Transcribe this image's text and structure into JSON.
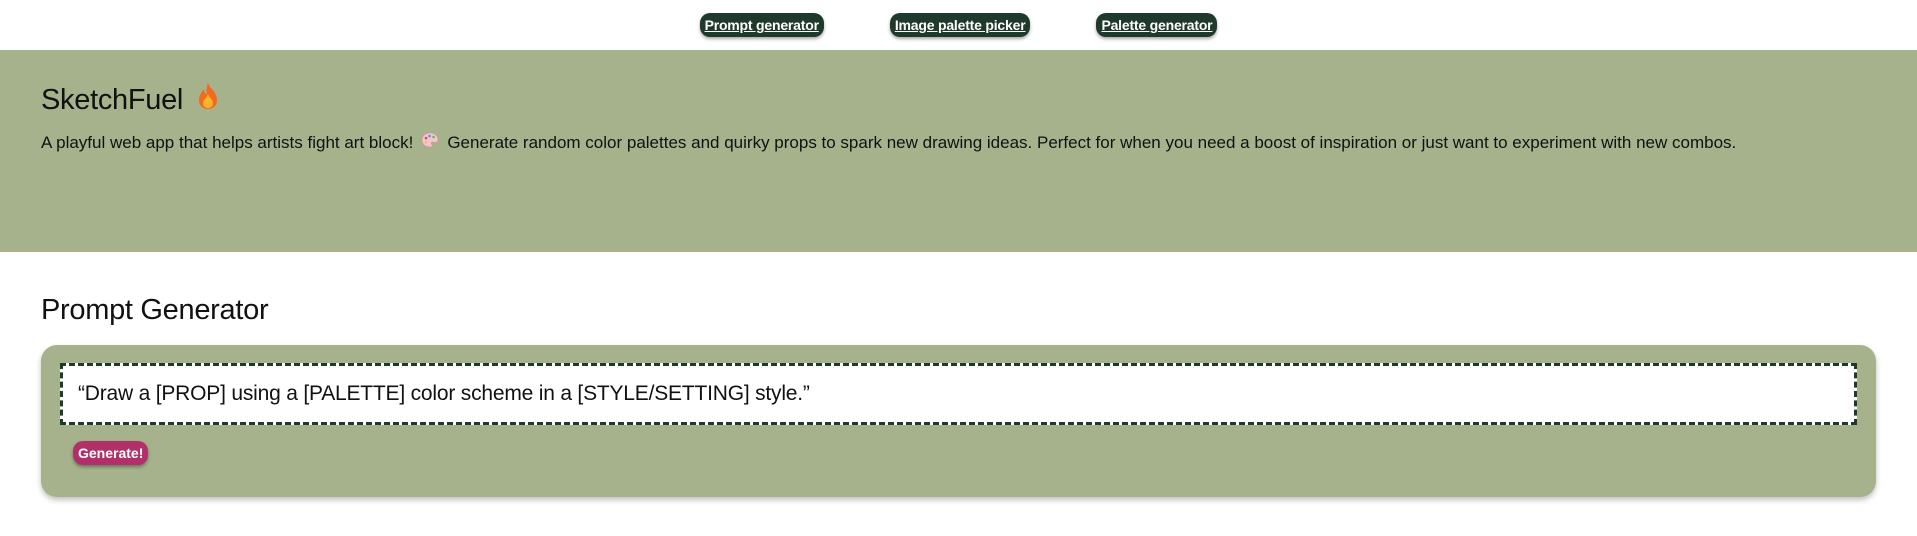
{
  "nav": {
    "items": [
      {
        "label": "Prompt generator"
      },
      {
        "label": "Image palette picker"
      },
      {
        "label": "Palette generator"
      }
    ]
  },
  "hero": {
    "title": "SketchFuel",
    "title_icon": "fire-icon",
    "description_before": "A playful web app that helps artists fight art block!",
    "description_icon": "artist-palette-icon",
    "description_after": "Generate random color palettes and quirky props to spark new drawing ideas. Perfect for when you need a boost of inspiration or just want to experiment with new combos."
  },
  "prompt_section": {
    "title": "Prompt Generator",
    "prompt_text": "“Draw a [PROP] using a [PALETTE] color scheme in a [STYLE/SETTING] style.”",
    "button_label": "Generate!"
  },
  "colors": {
    "sage": "#a5b28c",
    "dark_green": "#1f3a2c",
    "magenta": "#b0306a"
  }
}
